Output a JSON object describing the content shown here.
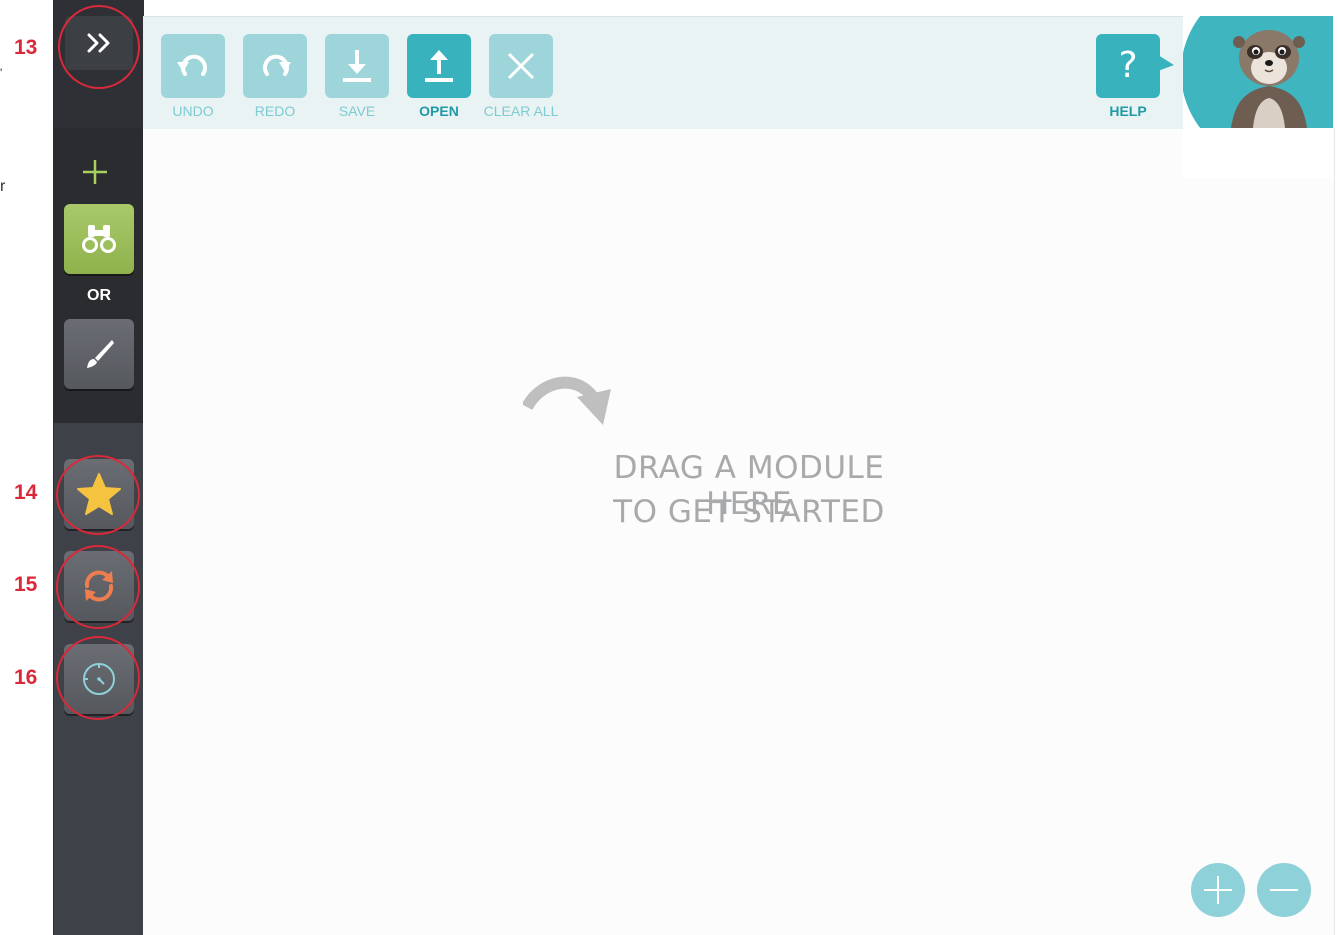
{
  "annotations": {
    "labels": [
      "13",
      "14",
      "15",
      "16"
    ],
    "edge_chars": [
      "r"
    ]
  },
  "sidebar": {
    "expand_icon": "double-chevron-right-icon",
    "add_icon": "plus-icon",
    "browse_icon": "binoculars-icon",
    "or_label": "OR",
    "draw_icon": "brush-icon",
    "favorites_icon": "star-icon",
    "sync_icon": "refresh-icon",
    "history_icon": "clock-icon"
  },
  "toolbar": {
    "undo_label": "UNDO",
    "redo_label": "REDO",
    "save_label": "SAVE",
    "open_label": "OPEN",
    "clear_label": "CLEAR ALL",
    "help_label": "HELP",
    "help_glyph": "?"
  },
  "canvas": {
    "hint_line1": "DRAG A MODULE HERE",
    "hint_line2": "TO GET STARTED"
  },
  "colors": {
    "accent": "#38b2bd",
    "accent_light": "#9dd5db",
    "annotation_red": "#d9293a",
    "sidebar_dark": "#2a2c30",
    "green_button": "#9bbf5a",
    "star_yellow": "#f6c341",
    "sync_orange": "#ee7e4f",
    "clock_blue": "#8fd1d8"
  }
}
